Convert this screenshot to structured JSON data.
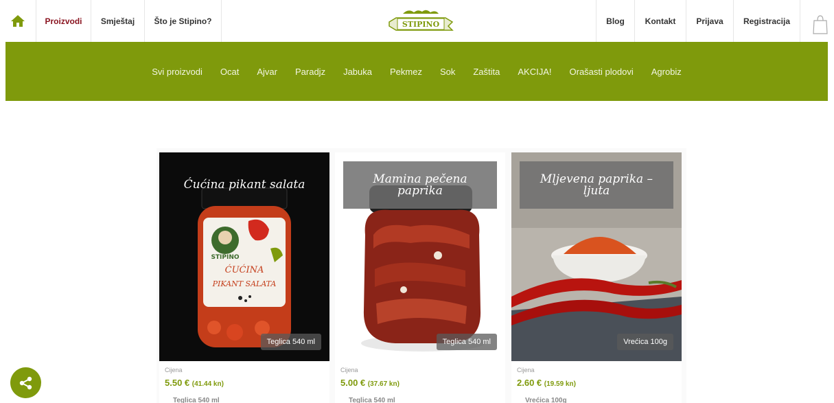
{
  "nav": {
    "home_icon": "home-icon",
    "left_items": [
      {
        "label": "Proizvodi",
        "active": true
      },
      {
        "label": "Smještaj",
        "active": false
      },
      {
        "label": "Što je Stipino?",
        "active": false
      }
    ],
    "right_items": [
      {
        "label": "Blog"
      },
      {
        "label": "Kontakt"
      },
      {
        "label": "Prijava"
      },
      {
        "label": "Registracija"
      }
    ],
    "logo_text": "STIPINO",
    "cart_icon": "shopping-bag-icon"
  },
  "categories": [
    "Svi proizvodi",
    "Ocat",
    "Ajvar",
    "Paradjz",
    "Jabuka",
    "Pekmez",
    "Sok",
    "Zaštita",
    "AKCIJA!",
    "Orašasti plodovi",
    "Agrobiz"
  ],
  "products": [
    {
      "title": "Ćućina pikant salata",
      "badge": "Teglica 540 ml",
      "price_label": "Cijena",
      "price_eur": "5.50 €",
      "price_kn": "(41.44 kn)",
      "pack": "Teglica 540 ml",
      "jar_label_brand": "STIPINO",
      "jar_label_name": "ĆUĆINA",
      "jar_label_sub": "PIKANT SALATA"
    },
    {
      "title": "Mamina pečena paprika",
      "badge": "Teglica 540 ml",
      "price_label": "Cijena",
      "price_eur": "5.00 €",
      "price_kn": "(37.67 kn)",
      "pack": "Teglica 540 ml"
    },
    {
      "title": "Mljevena paprika – ljuta",
      "badge": "Vrećica 100g",
      "price_label": "Cijena",
      "price_eur": "2.60 €",
      "price_kn": "(19.59 kn)",
      "pack": "Vrećica 100g"
    }
  ],
  "share_icon": "share-icon",
  "colors": {
    "brand_green": "#7f9a0c",
    "active_red": "#8a1420"
  }
}
